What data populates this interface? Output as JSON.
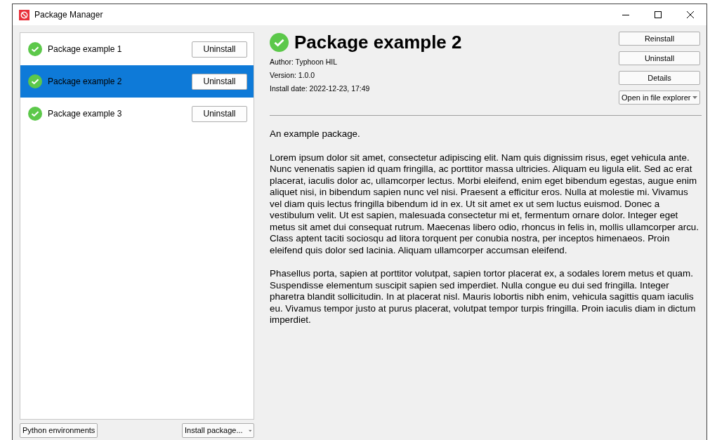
{
  "window": {
    "title": "Package Manager"
  },
  "packages": [
    {
      "name": "Package example 1",
      "installed": true,
      "selected": false,
      "action": "Uninstall"
    },
    {
      "name": "Package example 2",
      "installed": true,
      "selected": true,
      "action": "Uninstall"
    },
    {
      "name": "Package example 3",
      "installed": true,
      "selected": false,
      "action": "Uninstall"
    }
  ],
  "footer_buttons": [
    {
      "label": "Python environments",
      "dropdown": false
    },
    {
      "label": "Install package...",
      "dropdown": true
    }
  ],
  "details": {
    "title": "Package example 2",
    "installed": true,
    "meta": [
      "Author: Typhoon HIL",
      "Version: 1.0.0",
      "Install date: 2022-12-23, 17:49"
    ],
    "actions": [
      {
        "label": "Reinstall",
        "dropdown": false
      },
      {
        "label": "Uninstall",
        "dropdown": false
      },
      {
        "label": "Details",
        "dropdown": false
      },
      {
        "label": "Open in file explorer",
        "dropdown": true
      }
    ],
    "paragraphs": [
      "An example package.",
      "Lorem ipsum dolor sit amet, consectetur adipiscing elit. Nam quis dignissim risus, eget vehicula ante. Nunc venenatis sapien id quam fringilla, ac porttitor massa ultricies. Aliquam eu ligula elit. Sed ac erat placerat, iaculis dolor ac, ullamcorper lectus. Morbi eleifend, enim eget bibendum egestas, augue enim aliquet nisi, in bibendum sapien nunc vel nisi. Praesent a efficitur eros. Nulla at molestie mi. Vivamus vel diam quis lectus fringilla bibendum id in ex. Ut sit amet ex ut sem luctus euismod. Donec a vestibulum velit. Ut est sapien, malesuada consectetur mi et, fermentum ornare dolor. Integer eget metus sit amet dui consequat rutrum. Maecenas libero odio, rhoncus in felis in, mollis ullamcorper arcu. Class aptent taciti sociosqu ad litora torquent per conubia nostra, per inceptos himenaeos. Proin eleifend quis dolor sed lacinia. Aliquam ullamcorper accumsan eleifend.",
      "Phasellus porta, sapien at porttitor volutpat, sapien tortor placerat ex, a sodales lorem metus et quam. Suspendisse elementum suscipit sapien sed imperdiet. Nulla congue eu dui sed fringilla. Integer pharetra blandit sollicitudin. In at placerat nisl. Mauris lobortis nibh enim, vehicula sagittis quam iaculis eu. Vivamus tempor justo at purus placerat, volutpat tempor turpis fringilla. Proin iaculis diam in dictum imperdiet."
    ]
  }
}
